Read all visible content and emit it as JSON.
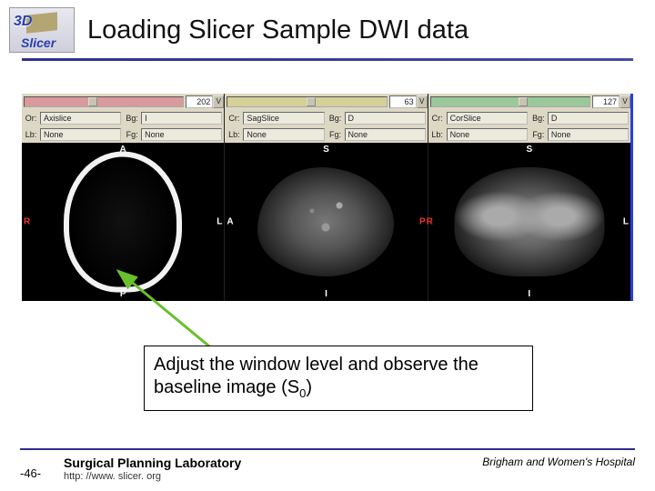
{
  "logo": {
    "top": "3D",
    "bottom": "Slicer"
  },
  "title": "Loading Slicer Sample DWI data",
  "panels": [
    {
      "id": "axial",
      "slice_value": "202",
      "row1": {
        "a_lbl": "Or:",
        "a_val": "Axislice",
        "b_lbl": "Bg:",
        "b_val": "I"
      },
      "row2": {
        "a_lbl": "Lb:",
        "a_val": "None",
        "b_lbl": "Fg:",
        "b_val": "None"
      },
      "orient": {
        "top": "A",
        "bottom": "P",
        "left": "R",
        "right": "L"
      }
    },
    {
      "id": "sagittal",
      "slice_value": "63",
      "row1": {
        "a_lbl": "Cr:",
        "a_val": "SagSlice",
        "b_lbl": "Bg:",
        "b_val": "D"
      },
      "row2": {
        "a_lbl": "Lb:",
        "a_val": "None",
        "b_lbl": "Fg:",
        "b_val": "None"
      },
      "orient": {
        "top": "S",
        "bottom": "I",
        "left": "A",
        "right": "P"
      }
    },
    {
      "id": "coronal",
      "slice_value": "127",
      "row1": {
        "a_lbl": "Cr:",
        "a_val": "CorSlice",
        "b_lbl": "Bg:",
        "b_val": "D"
      },
      "row2": {
        "a_lbl": "Lb:",
        "a_val": "None",
        "b_lbl": "Fg:",
        "b_val": "None"
      },
      "orient": {
        "top": "S",
        "bottom": "I",
        "left": "R",
        "right": "L"
      }
    }
  ],
  "callout_pre": "Adjust the window level and observe the baseline image (S",
  "callout_sub": "0",
  "callout_post": ")",
  "footer": {
    "page": "-46-",
    "lab": "Surgical Planning Laboratory",
    "url": "http: //www. slicer. org",
    "hospital": "Brigham and Women's Hospital"
  },
  "vbtn_glyph": "V"
}
